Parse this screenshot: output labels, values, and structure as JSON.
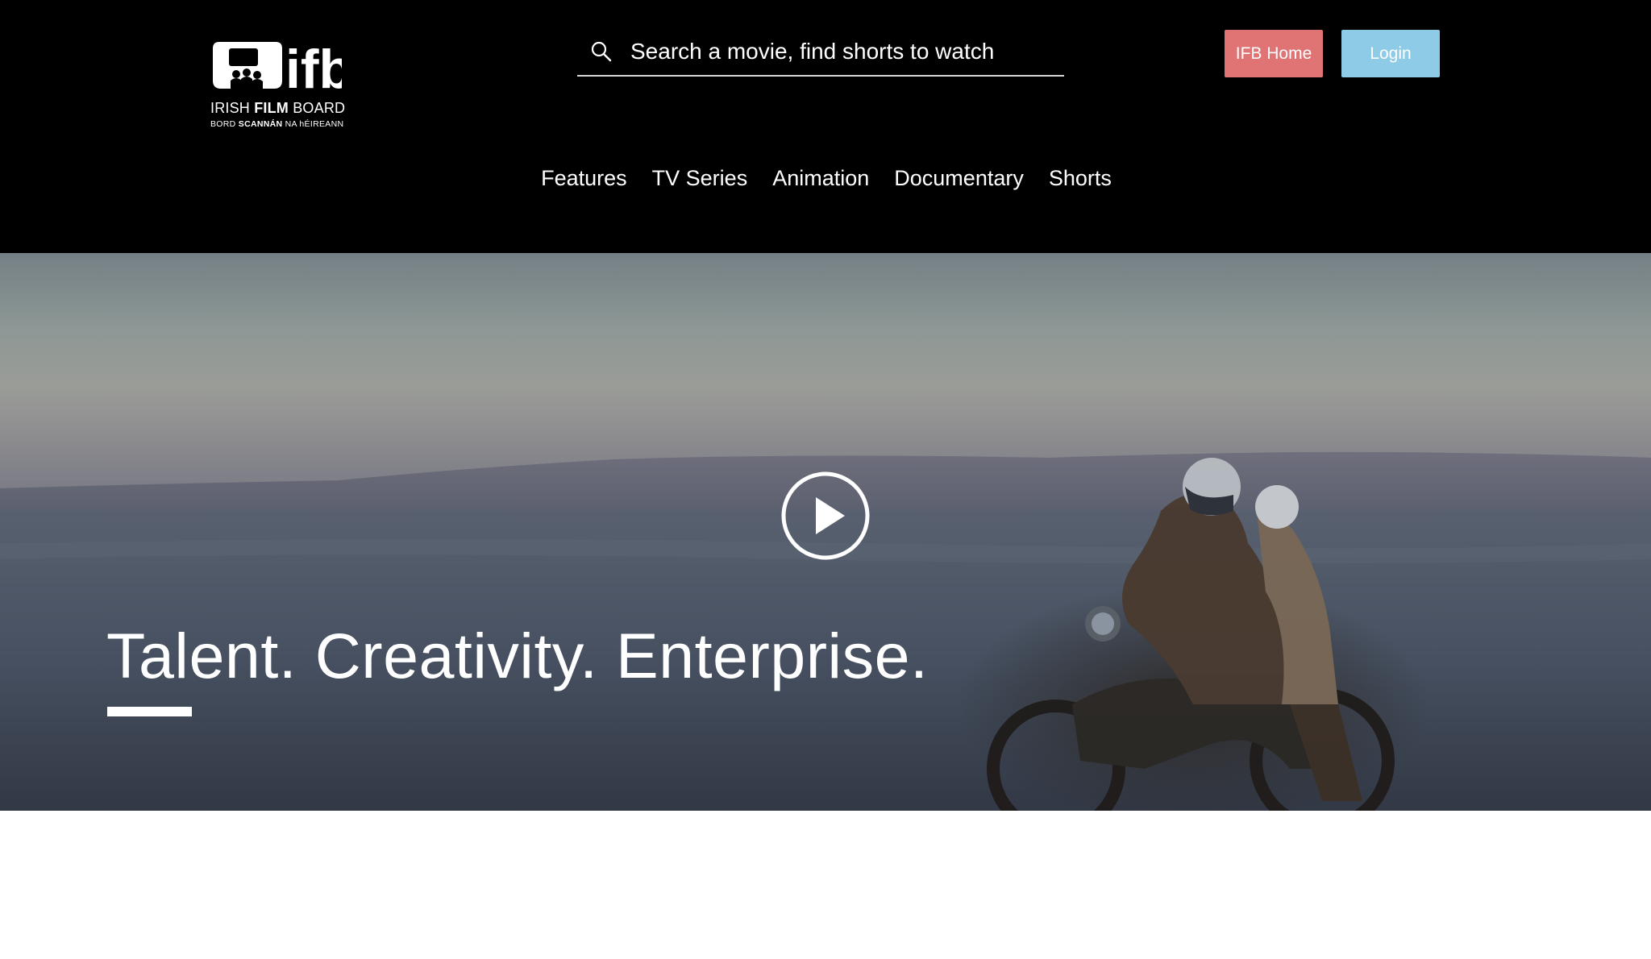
{
  "logo": {
    "brand_text": "ifb",
    "line1_regular": "IRISH ",
    "line1_bold": "FILM",
    "line1_end": " BOARD",
    "line2_regular": "BORD ",
    "line2_bold": "SCANNÁN",
    "line2_end": " NA hÉIREANN"
  },
  "search": {
    "placeholder": "Search a movie, find shorts to watch",
    "icon": "search-icon"
  },
  "buttons": {
    "ifb_home": "IFB Home",
    "login": "Login"
  },
  "nav": {
    "items": [
      {
        "label": "Features"
      },
      {
        "label": "TV Series"
      },
      {
        "label": "Animation"
      },
      {
        "label": "Documentary"
      },
      {
        "label": "Shorts"
      }
    ]
  },
  "hero": {
    "title": "Talent. Creativity. Enterprise.",
    "play_icon": "play-icon"
  },
  "colors": {
    "header_bg": "#000000",
    "ifb_home_bg": "#e07474",
    "login_bg": "#8ecbe7",
    "text": "#ffffff"
  }
}
